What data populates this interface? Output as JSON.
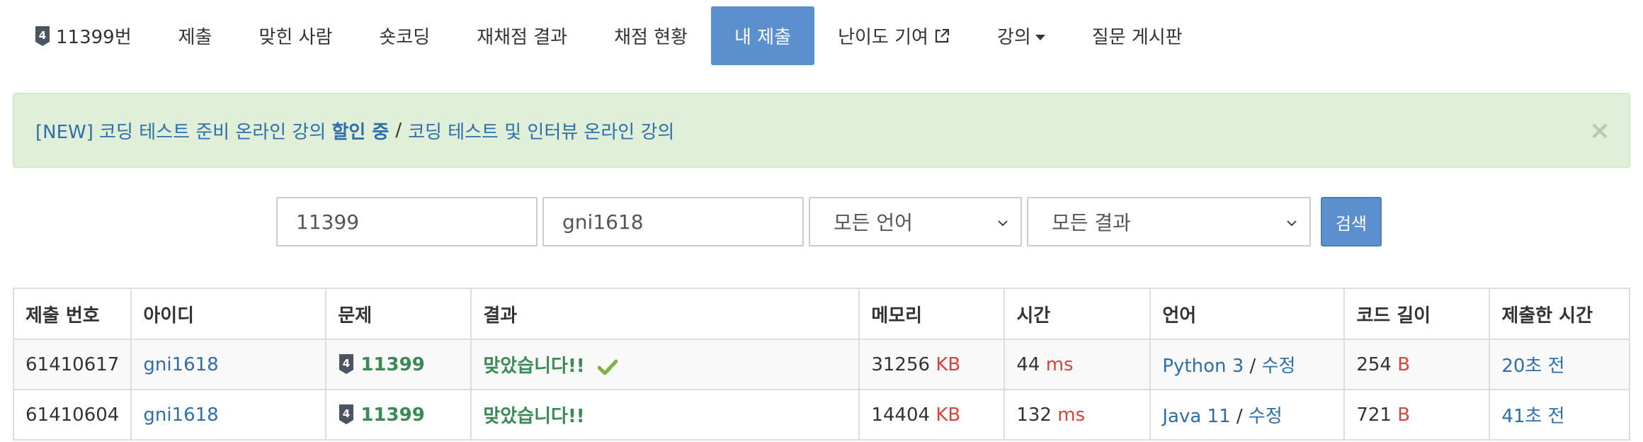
{
  "nav": {
    "problem_label": "11399번",
    "tier_icon": "tier-badge-icon",
    "tier_text": "4",
    "items": [
      {
        "label": "제출"
      },
      {
        "label": "맞힌 사람"
      },
      {
        "label": "숏코딩"
      },
      {
        "label": "재채점 결과"
      },
      {
        "label": "채점 현황"
      },
      {
        "label": "내 제출"
      },
      {
        "label": "난이도 기여"
      },
      {
        "label": "강의"
      },
      {
        "label": "질문 게시판"
      }
    ],
    "active_index": 5
  },
  "alert": {
    "text_a": "[NEW] 코딩 테스트 준비 온라인 강의",
    "text_b": "할인 중",
    "separator": "/",
    "text_c": "코딩 테스트 및 인터뷰 온라인 강의",
    "close": "×"
  },
  "search": {
    "problem_value": "11399",
    "user_value": "gni1618",
    "language": "모든 언어",
    "result": "모든 결과",
    "button": "검색"
  },
  "table": {
    "headers": [
      "제출 번호",
      "아이디",
      "문제",
      "결과",
      "메모리",
      "시간",
      "언어",
      "코드 길이",
      "제출한 시간"
    ],
    "rows": [
      {
        "id": "61410617",
        "user": "gni1618",
        "problem": "11399",
        "result": "맞았습니다!!",
        "memory": "31256",
        "memory_unit": "KB",
        "time": "44",
        "time_unit": "ms",
        "language": "Python 3",
        "lang_sep": "/",
        "edit": "수정",
        "code_length": "254",
        "code_unit": "B",
        "submitted": "20초 전"
      },
      {
        "id": "61410604",
        "user": "gni1618",
        "problem": "11399",
        "result": "맞았습니다!!",
        "memory": "14404",
        "memory_unit": "KB",
        "time": "132",
        "time_unit": "ms",
        "language": "Java 11",
        "lang_sep": "/",
        "edit": "수정",
        "code_length": "721",
        "code_unit": "B",
        "submitted": "41초 전"
      }
    ]
  },
  "colors": {
    "accent": "#5b8fcd",
    "link": "#2f6ea8",
    "correct": "#3b8a55",
    "unit": "#d6443c",
    "alert_bg": "#dfefd8"
  }
}
